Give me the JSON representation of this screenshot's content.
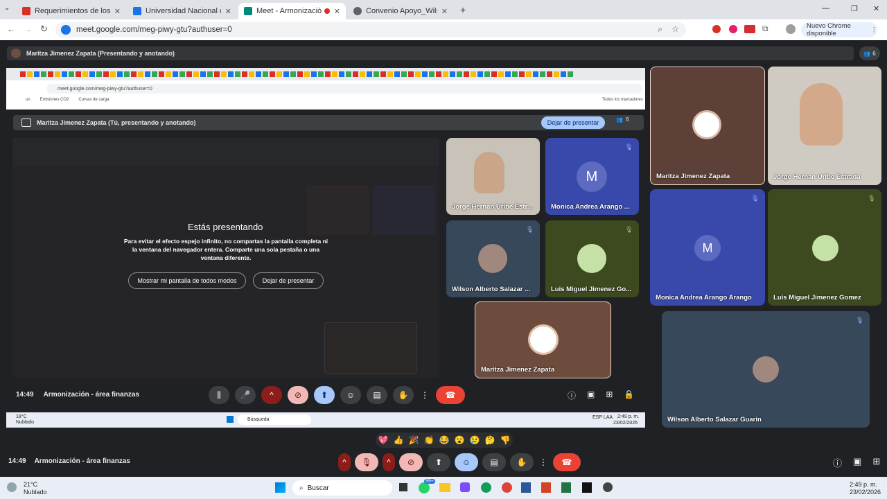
{
  "browser": {
    "tabs": [
      {
        "label": "Requerimientos de los laborato",
        "fav_color": "#d93025"
      },
      {
        "label": "Universidad Nacional de Colom",
        "fav_color": "#1a73e8"
      },
      {
        "label": "Meet - Armonización - área",
        "fav_color": "#00897b"
      },
      {
        "label": "Convenio Apoyo_Wilson_Tutor",
        "fav_color": "#5f6368"
      }
    ],
    "url": "meet.google.com/meg-piwy-gtu?authuser=0",
    "update_label": "Nuevo Chrome disponible"
  },
  "meet_bar": {
    "title": "Maritza Jimenez Zapata (Presentando y anotando)",
    "count": "6"
  },
  "inner_browser": {
    "url": "meet.google.com/meg-piwy-gtu?authuser=0",
    "bookmarks": [
      "un",
      "Emisiones CO2",
      "Curvas de carga"
    ],
    "all_bookmarks": "Todos los marcadores"
  },
  "inner_meet": {
    "header_title": "Maritza Jimenez Zapata (Tú, presentando y anotando)",
    "stop_button": "Dejar de presentar",
    "count": "6",
    "presenting_title": "Estás presentando",
    "presenting_body": "Para evitar el efecto espejo infinito, no compartas la pantalla completa ni la ventana del navegador entera. Comparte una sola pestaña o una ventana diferente.",
    "show_anyway": "Mostrar mi pantalla de todos modos",
    "stop_presenting": "Dejar de presentar",
    "time": "14:49",
    "meeting_name": "Armonización - área finanzas",
    "tiles": [
      {
        "name": "Jorge Hernan Uribe Estr..."
      },
      {
        "name": "Monica Andrea Arango ...",
        "initial": "M"
      },
      {
        "name": "Wilson Alberto Salazar ..."
      },
      {
        "name": "Luis Miguel Jimenez Go..."
      },
      {
        "name": "Maritza Jimenez Zapata"
      }
    ],
    "taskbar": {
      "temp": "18°C",
      "weather": "Nublado",
      "search": "Búsqueda",
      "lang": "ESP LAA",
      "clock": "2:49 p. m.",
      "date": "23/02/2026"
    }
  },
  "side_tiles": [
    {
      "name": "Maritza Jimenez Zapata"
    },
    {
      "name": "Jorge Hernan Uribe Estrada"
    },
    {
      "name": "Monica Andrea Arango Arango",
      "initial": "M"
    },
    {
      "name": "Luis Miguel Jimenez Gomez"
    },
    {
      "name": "Wilson Alberto Salazar Guarin"
    }
  ],
  "reactions": [
    "💖",
    "👍",
    "🎉",
    "👏",
    "😂",
    "😮",
    "😢",
    "🤔",
    "👎"
  ],
  "bottom_bar": {
    "time": "14:49",
    "meeting_name": "Armonización - área finanzas"
  },
  "taskbar": {
    "temp": "21°C",
    "weather": "Nublado",
    "search": "Buscar",
    "badge": "99+",
    "clock": "2:49 p. m.",
    "date": "23/02/2026"
  },
  "colors": {
    "end_call": "#ea4335",
    "accent": "#a8c7fa",
    "brown_tile": "#5d4037",
    "blue_tile": "#3949ab",
    "olive_tile": "#3d4a1f"
  }
}
